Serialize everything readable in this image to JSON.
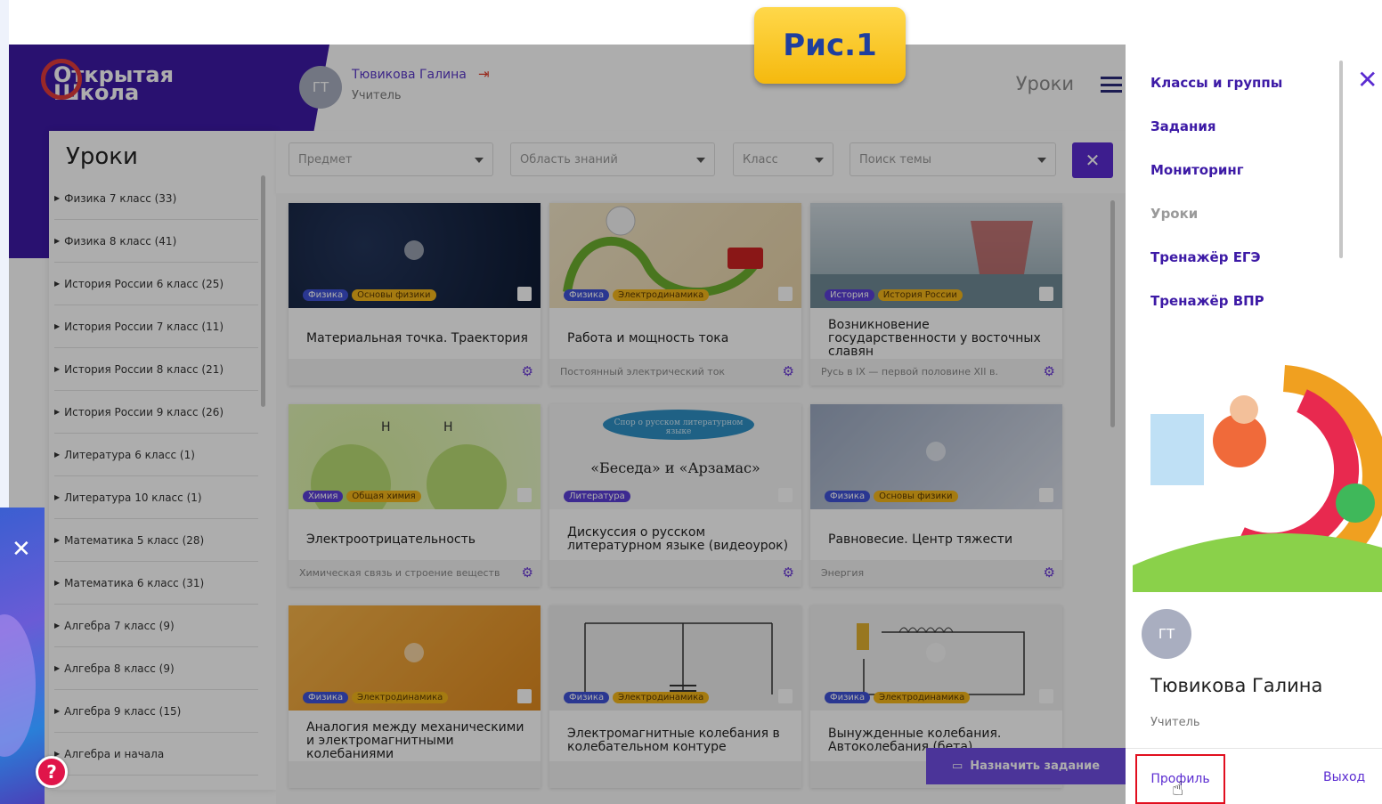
{
  "caption": "Рис.1",
  "app": {
    "logo_line1": "Открытая",
    "logo_line2": "Школа",
    "user_initials": "ГТ",
    "user_name": "Тювикова Галина",
    "user_role": "Учитель",
    "page_heading": "Уроки"
  },
  "sidebar": {
    "title": "Уроки",
    "items": [
      "Физика 7 класс (33)",
      "Физика 8 класс (41)",
      "История России 6 класс (25)",
      "История России 7 класс (11)",
      "История России 8 класс (21)",
      "История России 9 класс (26)",
      "Литература 6 класс (1)",
      "Литература 10 класс (1)",
      "Математика 5 класс (28)",
      "Математика 6 класс (31)",
      "Алгебра 7 класс (9)",
      "Алгебра 8 класс (9)",
      "Алгебра 9 класс (15)",
      "Алгебра и начала"
    ]
  },
  "filters": {
    "subject": "Предмет",
    "area": "Область знаний",
    "grade": "Класс",
    "topic": "Поиск темы"
  },
  "cards": [
    {
      "tags": [
        "Физика",
        "Основы физики"
      ],
      "title": "Материальная точка. Траектория",
      "sub": ""
    },
    {
      "tags": [
        "Физика",
        "Электродинамика"
      ],
      "title": "Работа и мощность тока",
      "sub": "Постоянный электрический ток"
    },
    {
      "tags": [
        "История",
        "История России"
      ],
      "title": "Возникновение государственности у восточных славян",
      "sub": "Русь в IX — первой половине XII в."
    },
    {
      "tags": [
        "Химия",
        "Общая химия"
      ],
      "title": "Электроотрицательность",
      "sub": "Химическая связь и строение веществ"
    },
    {
      "tags": [
        "Литература"
      ],
      "title": "Дискуссия о русском литературном языке (видеоурок)",
      "sub": "",
      "thumb_text": "«Беседа» и «Арзамас»",
      "thumb_sub": "Спор о русском литературном языке"
    },
    {
      "tags": [
        "Физика",
        "Основы физики"
      ],
      "title": "Равновесие. Центр тяжести",
      "sub": "Энергия"
    },
    {
      "tags": [
        "Физика",
        "Электродинамика"
      ],
      "title": "Аналогия между механическими и электромагнитными колебаниями",
      "sub": ""
    },
    {
      "tags": [
        "Физика",
        "Электродинамика"
      ],
      "title": "Электромагнитные колебания в колебательном контуре",
      "sub": ""
    },
    {
      "tags": [
        "Физика",
        "Электродинамика"
      ],
      "title": "Вынужденные колебания. Автоколебания (бета)",
      "sub": ""
    }
  ],
  "assign_button": "Назначить задание",
  "drawer": {
    "nav": [
      "Классы и группы",
      "Задания",
      "Мониторинг",
      "Уроки",
      "Тренажёр ЕГЭ",
      "Тренажёр ВПР"
    ],
    "initials": "ГТ",
    "name": "Тювикова Галина",
    "role": "Учитель",
    "profile": "Профиль",
    "exit": "Выход"
  }
}
